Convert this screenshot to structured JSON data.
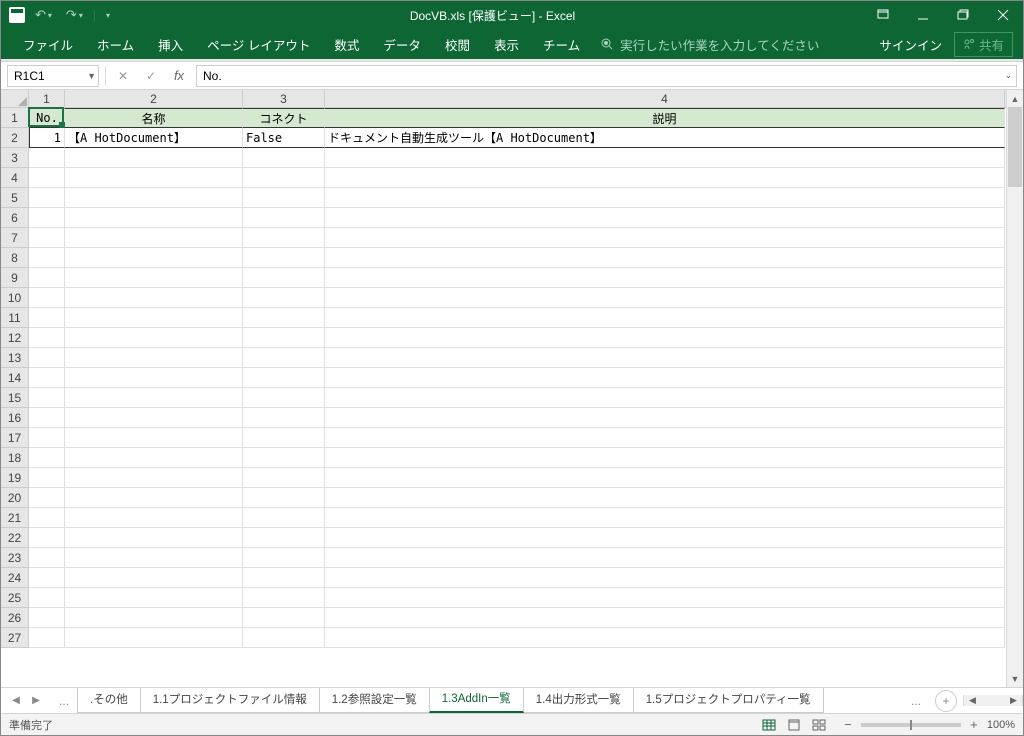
{
  "title": "DocVB.xls [保護ビュー] - Excel",
  "ribbon": {
    "file": "ファイル",
    "home": "ホーム",
    "insert": "挿入",
    "page_layout": "ページ レイアウト",
    "formulas": "数式",
    "data": "データ",
    "review": "校閲",
    "view": "表示",
    "team": "チーム",
    "tell_me": "実行したい作業を入力してください",
    "sign_in": "サインイン",
    "share": "共有"
  },
  "formula_bar": {
    "name_box": "R1C1",
    "formula": "No."
  },
  "columns": {
    "widths": [
      36,
      178,
      82,
      680
    ],
    "labels": [
      "1",
      "2",
      "3",
      "4"
    ]
  },
  "headers": [
    "No.",
    "名称",
    "コネクト",
    "説明"
  ],
  "data_row": {
    "no": "1",
    "name": "【A HotDocument】",
    "connect": "False",
    "desc": "ドキュメント自動生成ツール【A HotDocument】"
  },
  "visible_rows": 27,
  "sheets": {
    "ellipsis_left": "...",
    "tabs": [
      {
        "label": ".その他",
        "active": false
      },
      {
        "label": "1.1プロジェクトファイル情報",
        "active": false
      },
      {
        "label": "1.2参照設定一覧",
        "active": false
      },
      {
        "label": "1.3AddIn一覧",
        "active": true
      },
      {
        "label": "1.4出力形式一覧",
        "active": false
      },
      {
        "label": "1.5プロジェクトプロパティ一覧",
        "active": false
      }
    ],
    "ellipsis_right": "..."
  },
  "status": {
    "ready": "準備完了",
    "zoom": "100%"
  }
}
